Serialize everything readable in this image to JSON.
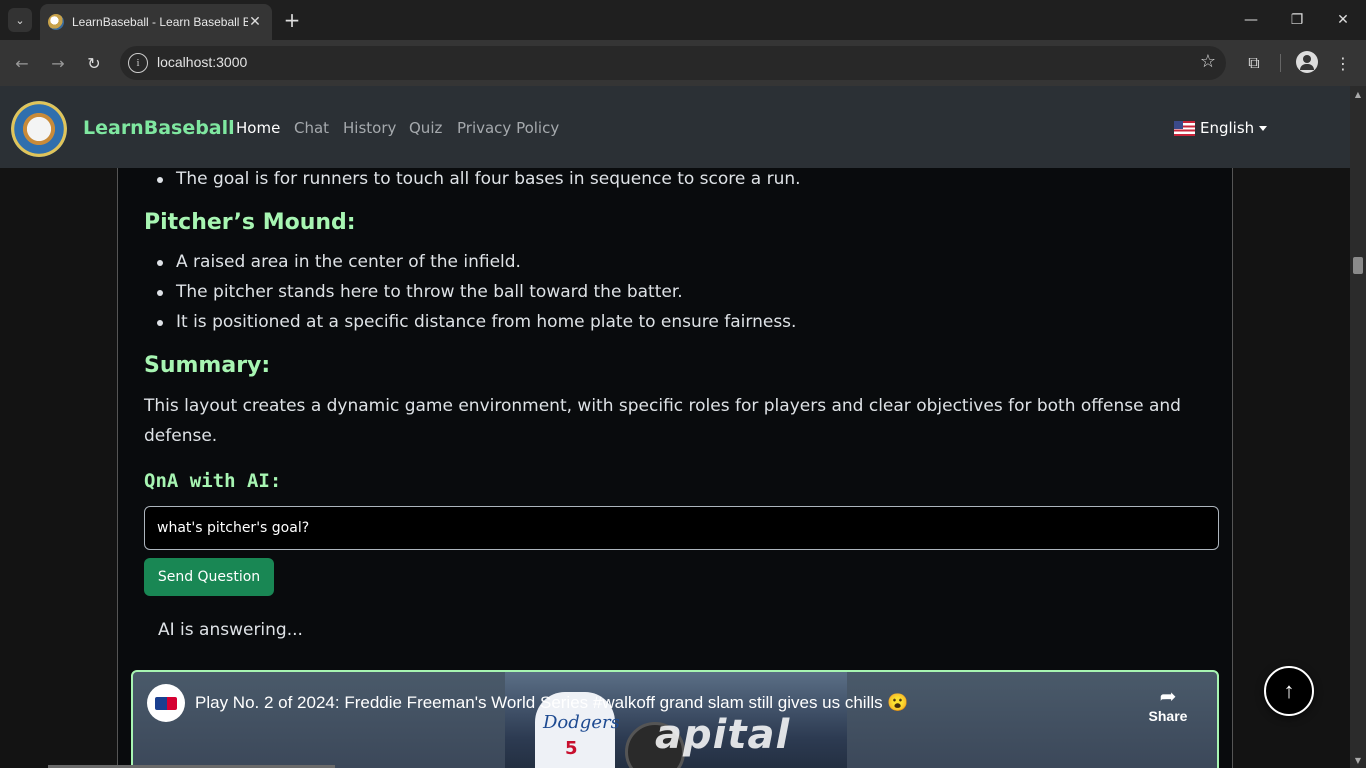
{
  "browser": {
    "tab_title": "LearnBaseball - Learn Baseball Basics",
    "url": "localhost:3000",
    "icons": {
      "tab_search": "chevron-down-icon",
      "close_tab": "close-icon",
      "new_tab": "plus-icon",
      "back": "arrow-left-icon",
      "forward": "arrow-right-icon",
      "reload": "reload-icon",
      "site_info": "info-icon",
      "bookmark": "star-icon",
      "extensions": "puzzle-icon",
      "profile": "avatar-icon",
      "menu": "kebab-menu-icon"
    }
  },
  "navbar": {
    "brand": "LearnBaseball",
    "links": [
      "Home",
      "Chat",
      "History",
      "Quiz",
      "Privacy Policy"
    ],
    "active_link": "Home",
    "language": "English"
  },
  "content": {
    "bases_items": [
      "The goal is for runners to touch all four bases in sequence to score a run."
    ],
    "mound_heading": "Pitcher’s Mound:",
    "mound_items": [
      "A raised area in the center of the infield.",
      "The pitcher stands here to throw the ball toward the batter.",
      "It is positioned at a specific distance from home plate to ensure fairness."
    ],
    "summary_heading": "Summary:",
    "summary_text": "This layout creates a dynamic game environment, with specific roles for players and clear objectives for both offense and defense."
  },
  "qna": {
    "heading": "QnA with AI:",
    "question_value": "what's pitcher's goal?",
    "send_label": "Send Question",
    "status": "AI is answering..."
  },
  "video": {
    "title": "Play No. 2 of 2024: Freddie Freeman's World Series #walkoff grand slam still gives us chills 😮",
    "share_label": "Share",
    "jersey_text": "Dodgers",
    "jersey_number": "5",
    "sign_text": "apital"
  },
  "colors": {
    "brand": "#7fe7a0",
    "heading": "#a7f5b2",
    "send_button": "#198754",
    "navbar_bg": "#2b3035"
  }
}
